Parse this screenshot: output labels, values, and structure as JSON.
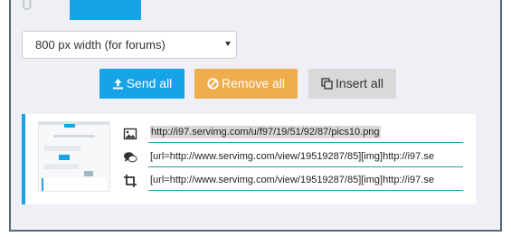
{
  "tabs": {
    "left_partial": "U"
  },
  "size_select": {
    "value": "800 px width (for forums)"
  },
  "actions": {
    "send_all": "Send all",
    "remove_all": "Remove all",
    "insert_all": "Insert all"
  },
  "upload_item": {
    "direct_link": "http://i97.servimg.com/u/f97/19/51/92/87/pics10.png",
    "forum_code": "[url=http://www.servimg.com/view/19519287/85][img]http://i97.se",
    "thumb_code": "[url=http://www.servimg.com/view/19519287/85][img]http://i97.se"
  },
  "icons": [
    "image-icon",
    "comment-icon",
    "crop-icon",
    "upload-icon",
    "ban-icon",
    "copy-icon"
  ],
  "colors": {
    "primary": "#16a3e8",
    "warning": "#f0ad4e",
    "neutral": "#d9d9d9",
    "field_underline": "#23a08e"
  }
}
